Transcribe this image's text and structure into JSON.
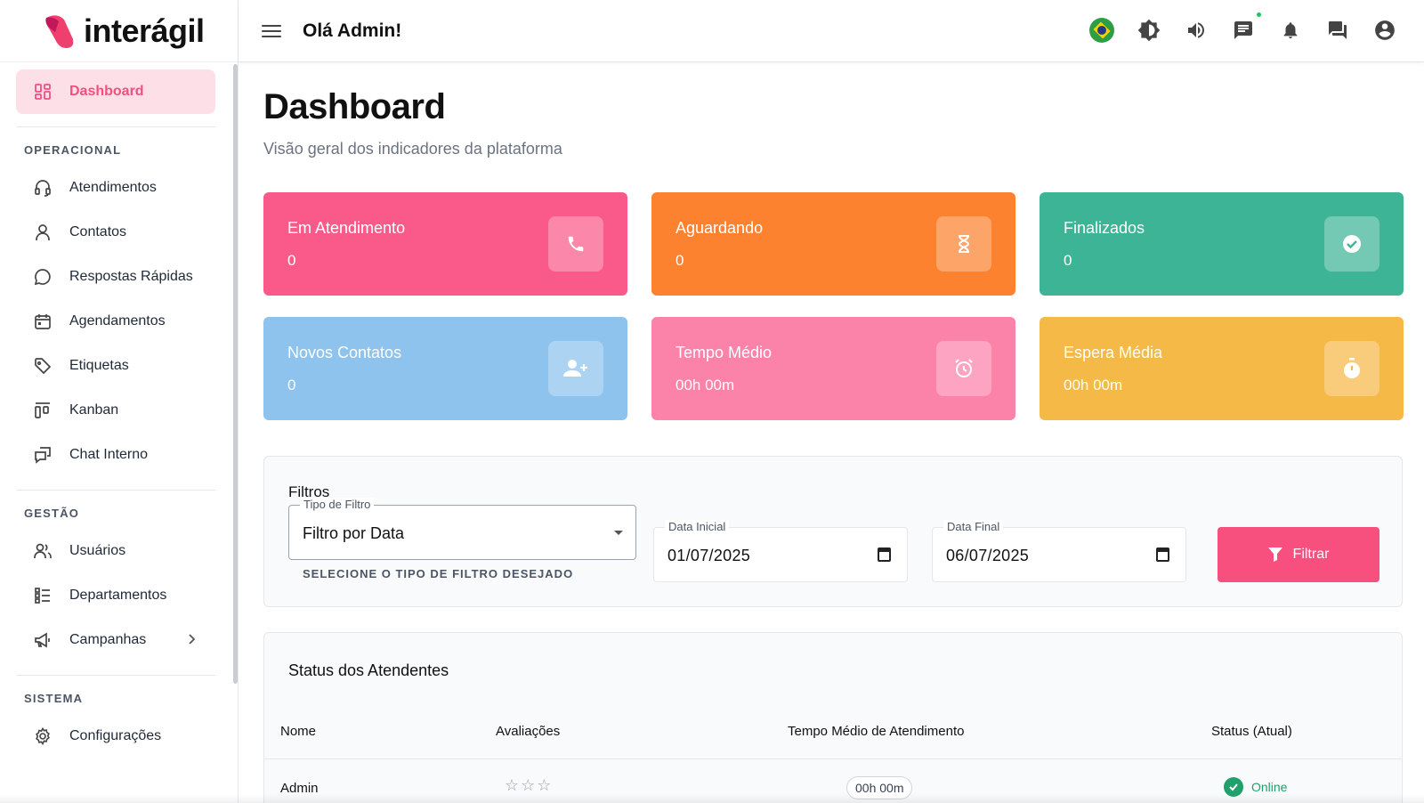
{
  "app": {
    "logo_text": "interágil",
    "greeting": "Olá Admin!"
  },
  "sidebar": {
    "active": "Dashboard",
    "top_item": {
      "label": "Dashboard",
      "icon": "dashboard-icon"
    },
    "sections": [
      {
        "heading": "OPERACIONAL",
        "items": [
          {
            "label": "Atendimentos",
            "icon": "headset-icon"
          },
          {
            "label": "Contatos",
            "icon": "person-icon"
          },
          {
            "label": "Respostas Rápidas",
            "icon": "chat-bubble-icon"
          },
          {
            "label": "Agendamentos",
            "icon": "calendar-icon"
          },
          {
            "label": "Etiquetas",
            "icon": "tag-icon"
          },
          {
            "label": "Kanban",
            "icon": "kanban-icon"
          },
          {
            "label": "Chat Interno",
            "icon": "internal-chat-icon"
          }
        ]
      },
      {
        "heading": "GESTÃO",
        "items": [
          {
            "label": "Usuários",
            "icon": "users-icon"
          },
          {
            "label": "Departamentos",
            "icon": "list-icon"
          },
          {
            "label": "Campanhas",
            "icon": "megaphone-icon"
          }
        ]
      },
      {
        "heading": "SISTEMA",
        "items": [
          {
            "label": "Configurações",
            "icon": "gear-icon"
          }
        ]
      }
    ]
  },
  "topbar_icons": [
    "brazil-flag-icon",
    "brightness-icon",
    "volume-icon",
    "message-icon",
    "bell-icon",
    "forum-icon",
    "account-icon"
  ],
  "page": {
    "title": "Dashboard",
    "subtitle": "Visão geral dos indicadores da plataforma"
  },
  "cards": [
    {
      "label": "Em Atendimento",
      "value": "0",
      "color": "#fa5a8a",
      "icon": "phone-icon"
    },
    {
      "label": "Aguardando",
      "value": "0",
      "color": "#fc822f",
      "icon": "hourglass-icon"
    },
    {
      "label": "Finalizados",
      "value": "0",
      "color": "#3eb497",
      "icon": "check-circle-icon"
    },
    {
      "label": "Novos Contatos",
      "value": "0",
      "color": "#8dc3ec",
      "icon": "add-user-icon"
    },
    {
      "label": "Tempo Médio",
      "value": "00h 00m",
      "color": "#fb82a9",
      "icon": "alarm-icon"
    },
    {
      "label": "Espera Média",
      "value": "00h 00m",
      "color": "#f5b947",
      "icon": "timer-icon"
    }
  ],
  "filters": {
    "title": "Filtros",
    "type_label": "Tipo de Filtro",
    "type_value": "Filtro por Data",
    "helper": "SELECIONE O TIPO DE FILTRO DESEJADO",
    "start_label": "Data Inicial",
    "start_value": "01/07/2025",
    "end_label": "Data Final",
    "end_value": "06/07/2025",
    "button": "Filtrar"
  },
  "status_table": {
    "title": "Status dos Atendentes",
    "columns": [
      "Nome",
      "Avaliações",
      "Tempo Médio de Atendimento",
      "Status (Atual)"
    ],
    "rows": [
      {
        "name": "Admin",
        "rating": "☆☆☆",
        "avg_time": "00h 00m",
        "status": "Online"
      }
    ]
  }
}
